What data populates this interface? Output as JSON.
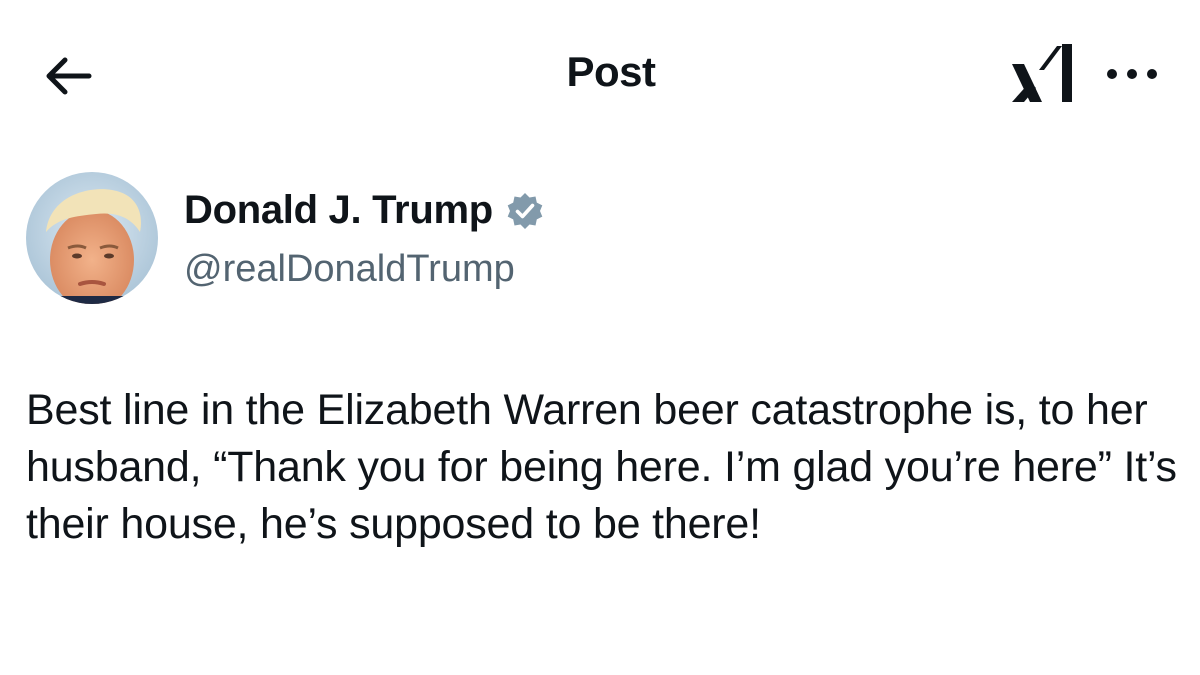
{
  "header": {
    "title": "Post",
    "back_icon": "arrow-left-icon",
    "logo_icon": "xai-logo-icon",
    "more_icon": "more-horizontal-icon"
  },
  "post": {
    "author": {
      "display_name": "Donald J. Trump",
      "handle": "@realDonaldTrump",
      "verified": true,
      "verified_color": "#829aab",
      "avatar_icon": "avatar-photo"
    },
    "text": "Best line in the Elizabeth Warren beer catastrophe is, to her husband, “Thank you for being here. I’m glad you’re here” It’s their house, he’s supposed to be there!"
  },
  "colors": {
    "text_primary": "#0f1419",
    "text_secondary": "#536471",
    "background": "#ffffff"
  }
}
